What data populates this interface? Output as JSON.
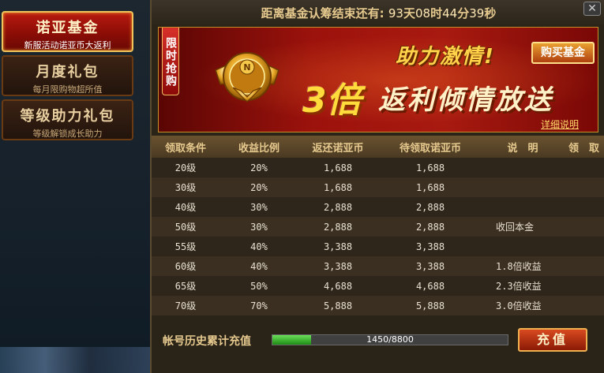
{
  "sidebar": {
    "items": [
      {
        "title": "诺亚基金",
        "subtitle": "新服活动诺亚币大返利",
        "active": true
      },
      {
        "title": "月度礼包",
        "subtitle": "每月限购物超所值",
        "active": false
      },
      {
        "title": "等级助力礼包",
        "subtitle": "等级解锁成长助力",
        "active": false
      }
    ]
  },
  "countdown": {
    "label": "距离基金认筹结束还有:",
    "days": "93",
    "days_unit": "天",
    "hours": "08",
    "hours_unit": "时",
    "minutes": "44",
    "minutes_unit": "分",
    "seconds": "39",
    "seconds_unit": "秒"
  },
  "banner": {
    "limited_tag": "限时抢购",
    "slogan": "助力激情!",
    "buy_button": "购买基金",
    "multiplier": "3倍",
    "headline": "返利倾情放送",
    "detail_link": "详细说明"
  },
  "table": {
    "headers": [
      "领取条件",
      "收益比例",
      "返还诺亚币",
      "待领取诺亚币",
      "说　明",
      "领　取"
    ],
    "rows": [
      {
        "level": "20级",
        "ratio": "20%",
        "refund": "1,688",
        "pending": "1,688",
        "note": ""
      },
      {
        "level": "30级",
        "ratio": "20%",
        "refund": "1,688",
        "pending": "1,688",
        "note": ""
      },
      {
        "level": "40级",
        "ratio": "30%",
        "refund": "2,888",
        "pending": "2,888",
        "note": ""
      },
      {
        "level": "50级",
        "ratio": "30%",
        "refund": "2,888",
        "pending": "2,888",
        "note": "收回本金"
      },
      {
        "level": "55级",
        "ratio": "40%",
        "refund": "3,388",
        "pending": "3,388",
        "note": ""
      },
      {
        "level": "60级",
        "ratio": "40%",
        "refund": "3,388",
        "pending": "3,388",
        "note": "1.8倍收益"
      },
      {
        "level": "65级",
        "ratio": "50%",
        "refund": "4,688",
        "pending": "4,688",
        "note": "2.3倍收益"
      },
      {
        "level": "70级",
        "ratio": "70%",
        "refund": "5,888",
        "pending": "5,888",
        "note": "3.0倍收益"
      }
    ]
  },
  "footer": {
    "recharge_label": "帐号历史累计充值",
    "progress_text": "1450/8800",
    "progress_fraction": 0.165,
    "recharge_button": "充值"
  },
  "colors": {
    "accent_gold": "#e6c98e",
    "banner_red": "#9c120c",
    "progress_green": "#3cb82a"
  },
  "icons": {
    "medal": "winged-n-medal-icon",
    "close": "close-icon"
  }
}
